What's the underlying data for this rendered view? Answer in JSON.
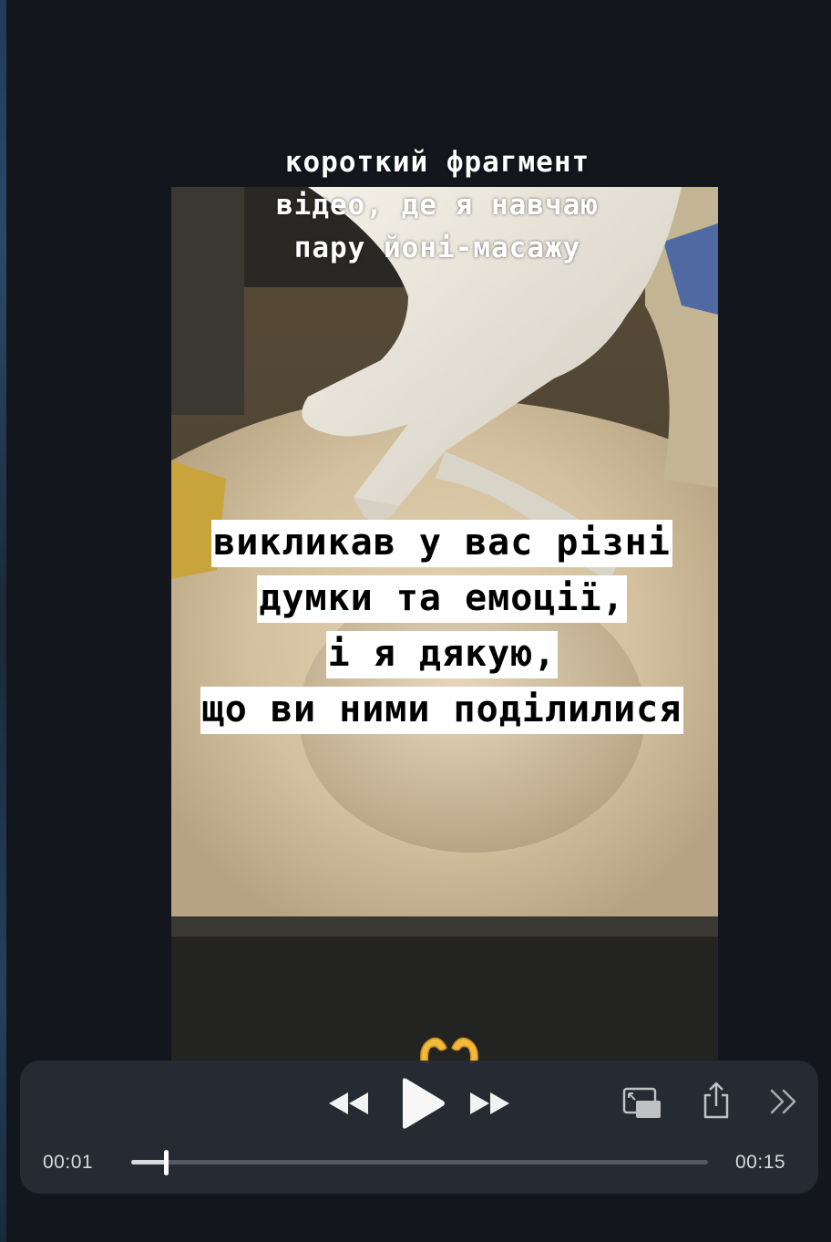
{
  "video": {
    "caption_top": [
      "короткий фрагмент",
      "відео, де я навчаю",
      "пару йоні-масажу"
    ],
    "caption_main": [
      "викликав у вас різні",
      "думки та емоції,",
      "і я дякую,",
      "що ви ними поділилися"
    ],
    "emoji": "heart-hands"
  },
  "player": {
    "current_time": "00:01",
    "duration": "00:15",
    "progress": 0.06,
    "buttons": {
      "rewind": "rewind-icon",
      "play": "play-icon",
      "fast_forward": "fast-forward-icon",
      "picture_in_picture": "picture-in-picture-icon",
      "share": "share-icon",
      "more": "chevron-double-right-icon"
    }
  },
  "colors": {
    "background": "#13161d",
    "controls_bg": "#2a2e35",
    "caption_highlight": "#ffffff",
    "progress_fill": "#d9dadc"
  }
}
